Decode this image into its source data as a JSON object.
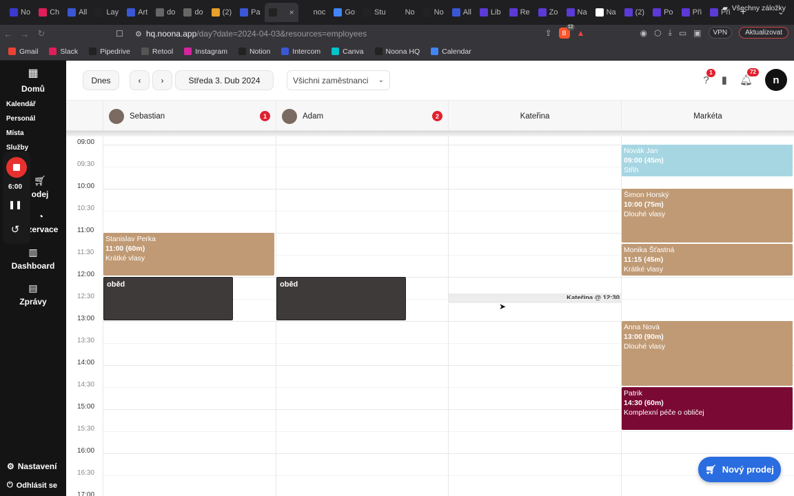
{
  "browser": {
    "tabs": [
      {
        "label": "No",
        "icon": "noona-icon",
        "color": "#3a3ad0"
      },
      {
        "label": "Ch",
        "icon": "slack-icon",
        "color": "#e01e5a"
      },
      {
        "label": "All",
        "icon": "intercom-icon",
        "color": "#3a57d6"
      },
      {
        "label": "Lay",
        "icon": "pipedrive-icon",
        "color": "#222"
      },
      {
        "label": "Art",
        "icon": "intercom-icon",
        "color": "#3a57d6"
      },
      {
        "label": "do",
        "icon": "globe-icon",
        "color": "#666"
      },
      {
        "label": "do",
        "icon": "globe-icon",
        "color": "#666"
      },
      {
        "label": "(2)",
        "icon": "hand-icon",
        "color": "#e8a02a"
      },
      {
        "label": "Pa",
        "icon": "intercom-icon",
        "color": "#3a57d6"
      },
      {
        "label": "",
        "icon": "noona-icon",
        "color": "#222",
        "active": true
      },
      {
        "label": "noc",
        "icon": "blank-icon",
        "color": "#1f1f22"
      },
      {
        "label": "Go",
        "icon": "google-icon",
        "color": "#4285f4"
      },
      {
        "label": "Stu",
        "icon": "pipedrive-icon",
        "color": "#222"
      },
      {
        "label": "No",
        "icon": "blank-icon",
        "color": "#1f1f22"
      },
      {
        "label": "No",
        "icon": "noona-icon",
        "color": "#222"
      },
      {
        "label": "All",
        "icon": "intercom-icon",
        "color": "#3a57d6"
      },
      {
        "label": "Lib",
        "icon": "gear-icon",
        "color": "#5b3ad6"
      },
      {
        "label": "Re",
        "icon": "gear-icon",
        "color": "#5b3ad6"
      },
      {
        "label": "Zo",
        "icon": "gear-icon",
        "color": "#5b3ad6"
      },
      {
        "label": "Na",
        "icon": "gear-icon",
        "color": "#5b3ad6"
      },
      {
        "label": "Na",
        "icon": "notion-icon",
        "color": "#fff"
      },
      {
        "label": "(2)",
        "icon": "gear-icon",
        "color": "#5b3ad6"
      },
      {
        "label": "Po",
        "icon": "gear-icon",
        "color": "#5b3ad6"
      },
      {
        "label": "Při",
        "icon": "gear-icon",
        "color": "#5b3ad6"
      },
      {
        "label": "Při",
        "icon": "gear-icon",
        "color": "#5b3ad6"
      }
    ],
    "url_host": "hq.noona.app",
    "url_path": "/day?date=2024-04-03&resources=employees",
    "vpn_label": "VPN",
    "update_label": "Aktualizovat",
    "brave_count": "12",
    "alert_count": "1",
    "bookmarks": [
      {
        "label": "Gmail",
        "icon": "gmail-icon",
        "color": "#ea4335"
      },
      {
        "label": "Slack",
        "icon": "slack-icon",
        "color": "#e01e5a"
      },
      {
        "label": "Pipedrive",
        "icon": "pipedrive-icon",
        "color": "#222"
      },
      {
        "label": "Retool",
        "icon": "retool-icon",
        "color": "#555"
      },
      {
        "label": "Instagram",
        "icon": "instagram-icon",
        "color": "#d6249f"
      },
      {
        "label": "Notion",
        "icon": "notion-icon",
        "color": "#222"
      },
      {
        "label": "Intercom",
        "icon": "intercom-icon",
        "color": "#3a57d6"
      },
      {
        "label": "Canva",
        "icon": "canva-icon",
        "color": "#00c4cc"
      },
      {
        "label": "Noona HQ",
        "icon": "noona-icon",
        "color": "#222"
      },
      {
        "label": "Calendar",
        "icon": "calendar-icon",
        "color": "#4285f4"
      }
    ],
    "all_bookmarks_label": "Všechny záložky"
  },
  "sidebar": {
    "home_label": "Domů",
    "sub_items": [
      "Kalendář",
      "Personál",
      "Místa",
      "Služby"
    ],
    "sale_label": "odej",
    "reservations_label": "ezervace",
    "dashboard_label": "Dashboard",
    "messages_label": "Zprávy",
    "settings_label": "Nastavení",
    "logout_label": "Odhlásit se",
    "recorder_time": "6:00"
  },
  "toolbar": {
    "today_label": "Dnes",
    "date_label": "Středa 3. Dub 2024",
    "employee_filter": "Všichni zaměstnanci",
    "help_badge": "1",
    "notif_badge": "72",
    "logo_letter": "n"
  },
  "resources": [
    {
      "name": "Sebastian",
      "badge": "1",
      "has_avatar": true
    },
    {
      "name": "Adam",
      "badge": "2",
      "has_avatar": true
    },
    {
      "name": "Kateřina",
      "badge": "",
      "has_avatar": false
    },
    {
      "name": "Markéta",
      "badge": "",
      "has_avatar": false
    }
  ],
  "time_labels": [
    "09:00",
    "09:30",
    "10:00",
    "10:30",
    "11:00",
    "11:30",
    "12:00",
    "12:30",
    "13:00",
    "13:30",
    "14:00",
    "14:30",
    "15:00",
    "15:30",
    "16:00",
    "16:30",
    "17:00"
  ],
  "appointments": [
    {
      "col": 0,
      "name": "Stanislav Perka",
      "time": "11:00 (60m)",
      "service": "Krátké vlasy",
      "color": "#c09a74"
    },
    {
      "col": 3,
      "name": "Novák Jan",
      "time": "09:00 (45m)",
      "service": "Střih",
      "color": "#a7d6e3"
    },
    {
      "col": 3,
      "name": "Šimon Horský",
      "time": "10:00 (75m)",
      "service": "Dlouhé vlasy",
      "color": "#c09a74"
    },
    {
      "col": 3,
      "name": "Monika Šťastná",
      "time": "11:15 (45m)",
      "service": "Krátké vlasy",
      "color": "#c09a74"
    },
    {
      "col": 3,
      "name": "Anna Nová",
      "time": "13:00 (90m)",
      "service": "Dlouhé vlasy",
      "color": "#c09a74"
    },
    {
      "col": 3,
      "name": "Patrik",
      "time": "14:30 (60m)",
      "service": "Komplexní péče o obličej",
      "color": "#7a0a33"
    }
  ],
  "breaks": [
    {
      "col": 0,
      "label": "oběd"
    },
    {
      "col": 1,
      "label": "oběd"
    }
  ],
  "now_indicator": "Kateřina @ 12:30",
  "fab_label": "Nový prodej"
}
